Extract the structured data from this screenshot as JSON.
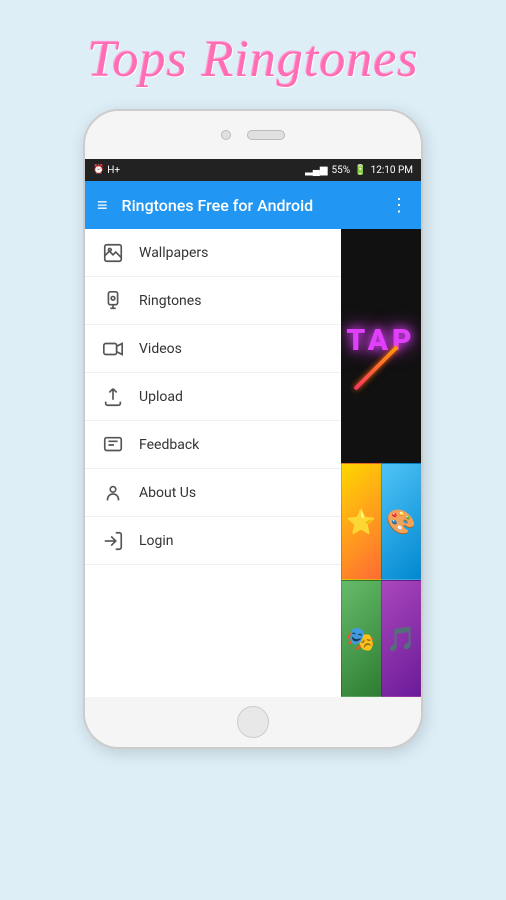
{
  "app": {
    "title": "Tops Ringtones"
  },
  "statusBar": {
    "alarm": "⏰",
    "hplus": "H+",
    "signal": "▂▄▆",
    "battery": "55%",
    "time": "12:10 PM"
  },
  "toolbar": {
    "title": "Ringtones Free for Android",
    "menuIcon": "≡",
    "moreIcon": "⋮"
  },
  "menu": {
    "items": [
      {
        "id": "wallpapers",
        "label": "Wallpapers"
      },
      {
        "id": "ringtones",
        "label": "Ringtones"
      },
      {
        "id": "videos",
        "label": "Videos"
      },
      {
        "id": "upload",
        "label": "Upload"
      },
      {
        "id": "feedback",
        "label": "Feedback"
      },
      {
        "id": "about-us",
        "label": "About Us"
      },
      {
        "id": "login",
        "label": "Login"
      }
    ]
  },
  "content": {
    "tapText": "TAP",
    "gridCells": [
      "🌟",
      "🎨",
      "🎭",
      "🎵"
    ]
  }
}
